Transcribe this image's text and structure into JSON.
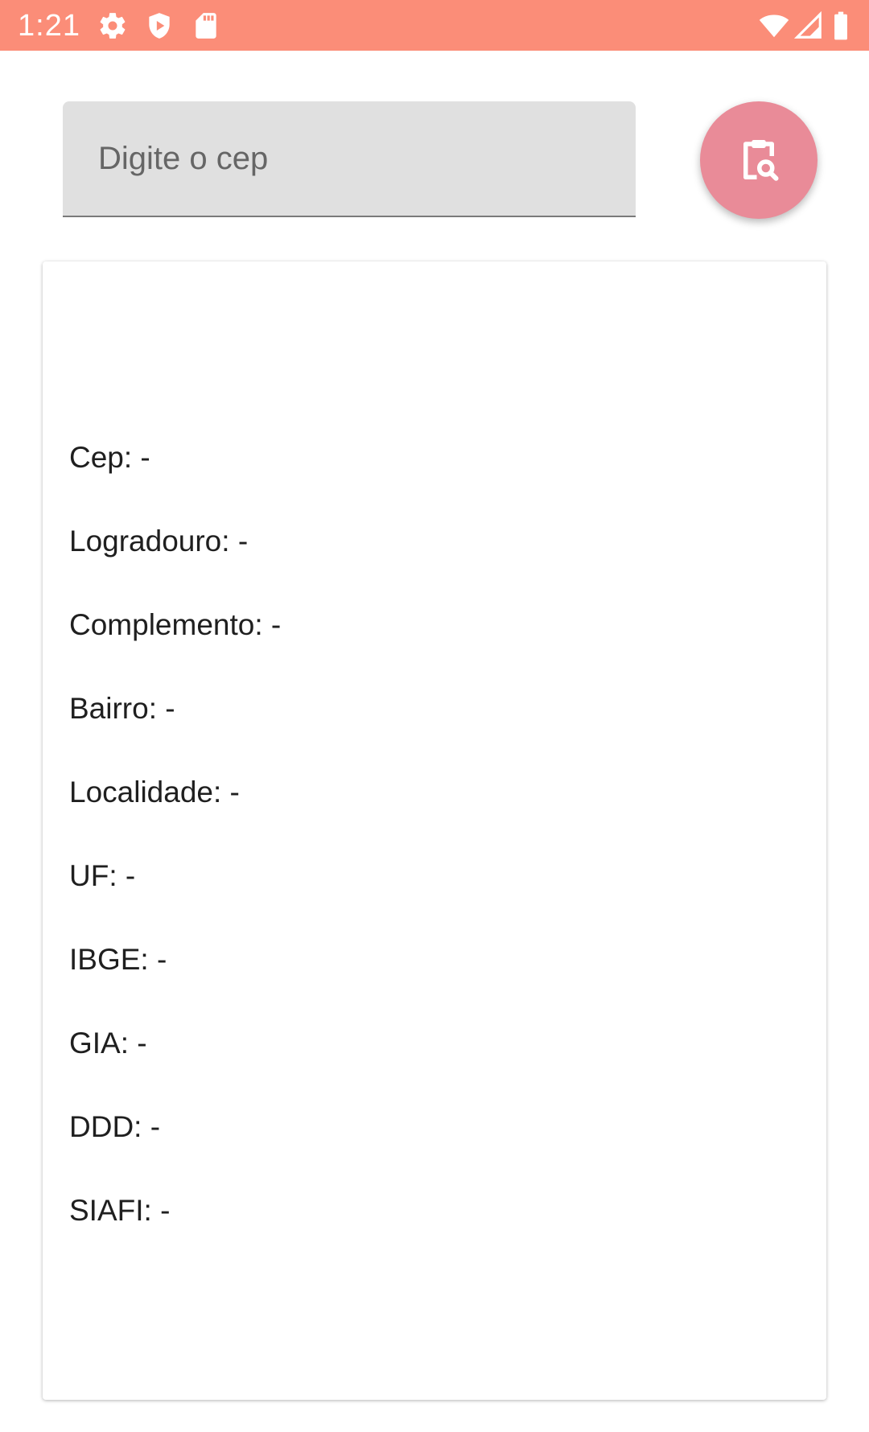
{
  "status_bar": {
    "time": "1:21",
    "icons": [
      "gear-icon",
      "shield-play-icon",
      "sd-card-icon",
      "wifi-icon",
      "signal-icon",
      "battery-icon"
    ],
    "background_color": "#fb8d78"
  },
  "search": {
    "placeholder": "Digite o cep",
    "value": ""
  },
  "search_button": {
    "icon": "clipboard-search-icon",
    "color": "#e98b98"
  },
  "result": {
    "cep": "Cep: -",
    "logradouro": "Logradouro: -",
    "complemento": "Complemento: -",
    "bairro": "Bairro: -",
    "localidade": "Localidade: -",
    "uf": "UF: -",
    "ibge": "IBGE: -",
    "gia": "GIA: -",
    "ddd": "DDD: -",
    "siafi": "SIAFI: -"
  }
}
